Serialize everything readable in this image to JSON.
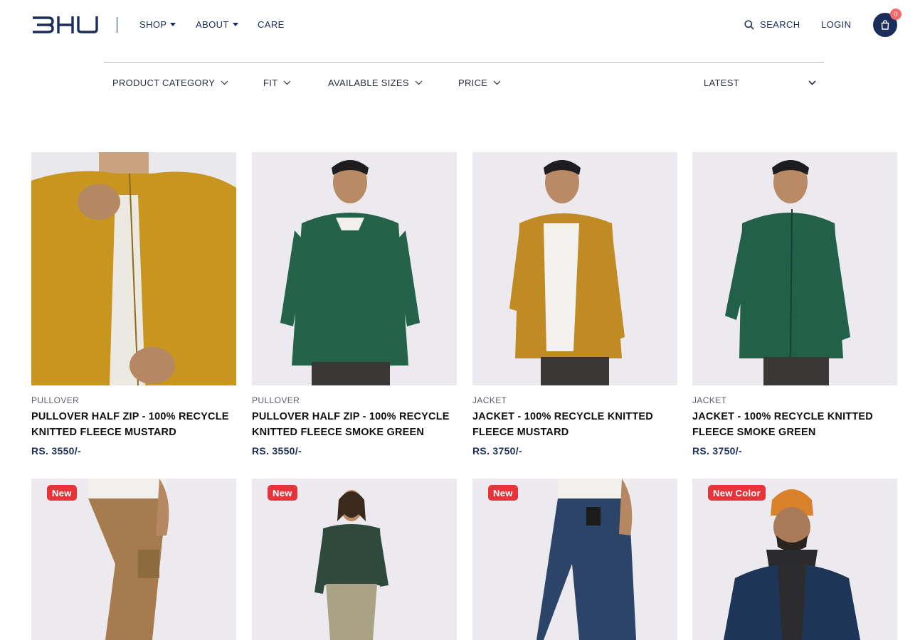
{
  "header": {
    "logo_text": "BHU",
    "nav": [
      {
        "label": "SHOP",
        "has_dropdown": true
      },
      {
        "label": "ABOUT",
        "has_dropdown": true
      },
      {
        "label": "CARE",
        "has_dropdown": false
      }
    ],
    "search_label": "SEARCH",
    "login_label": "LOGIN",
    "cart_count": "0",
    "icons": {
      "search": "search-icon",
      "cart": "shopping-bag-icon",
      "caret": "caret-down-icon"
    }
  },
  "filters": {
    "items": [
      {
        "label": "PRODUCT CATEGORY"
      },
      {
        "label": "FIT"
      },
      {
        "label": "AVAILABLE SIZES"
      },
      {
        "label": "PRICE"
      }
    ],
    "sort_label": "LATEST"
  },
  "products": [
    {
      "category": "PULLOVER",
      "title": "PULLOVER HALF ZIP - 100% RECYCLE KNITTED FLEECE MUSTARD",
      "price": "RS. 3550/-",
      "badge": "",
      "color": "#c8961f"
    },
    {
      "category": "PULLOVER",
      "title": "PULLOVER HALF ZIP - 100% RECYCLE KNITTED FLEECE SMOKE GREEN",
      "price": "RS. 3550/-",
      "badge": "",
      "color": "#24624a"
    },
    {
      "category": "JACKET",
      "title": "JACKET - 100% RECYCLE KNITTED FLEECE MUSTARD",
      "price": "RS. 3750/-",
      "badge": "",
      "color": "#c08a25"
    },
    {
      "category": "JACKET",
      "title": "JACKET - 100% RECYCLE KNITTED FLEECE SMOKE GREEN",
      "price": "RS. 3750/-",
      "badge": "",
      "color": "#22604a"
    },
    {
      "category": "",
      "title": "",
      "price": "",
      "badge": "New",
      "color": "#a67c4e"
    },
    {
      "category": "",
      "title": "",
      "price": "",
      "badge": "New",
      "color": "#2f4a3c"
    },
    {
      "category": "",
      "title": "",
      "price": "",
      "badge": "New",
      "color": "#2c4468"
    },
    {
      "category": "",
      "title": "",
      "price": "",
      "badge": "New Color",
      "color": "#1f3557"
    }
  ],
  "colors": {
    "brand": "#1b2d5a",
    "badge": "#e7343b",
    "cart_badge": "#f26a6a"
  }
}
